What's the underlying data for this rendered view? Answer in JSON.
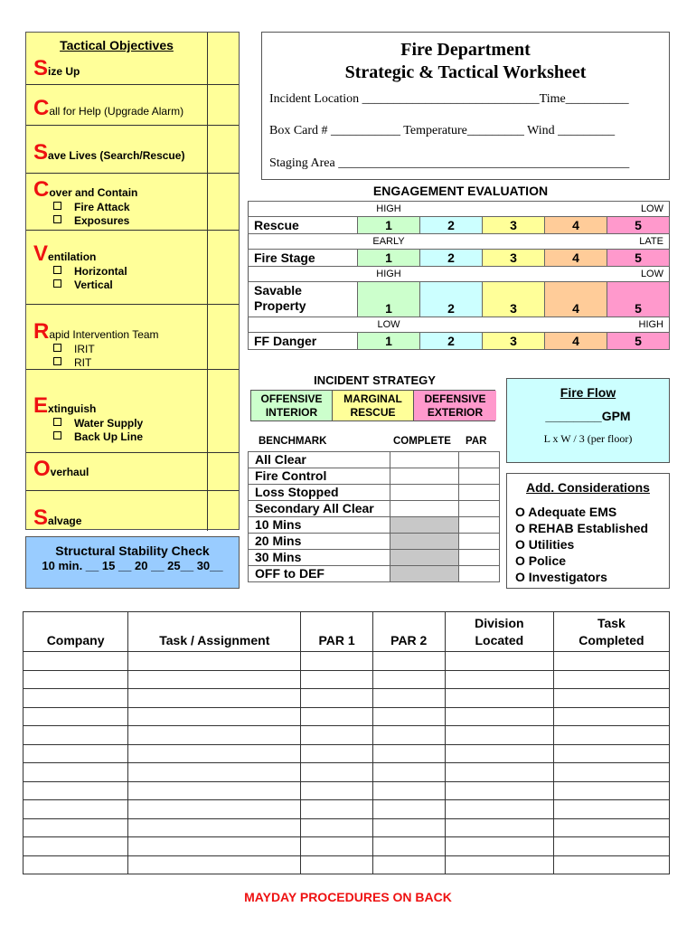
{
  "tactical_objectives": {
    "title": "Tactical Objectives",
    "items": [
      {
        "letter": "S",
        "rest": "ize Up",
        "subs": []
      },
      {
        "letter": "C",
        "rest": "all for Help (Upgrade Alarm)",
        "subs": []
      },
      {
        "letter": "S",
        "rest": "ave Lives  (Search/Rescue)",
        "subs": []
      },
      {
        "letter": "C",
        "rest": "over and Contain",
        "subs": [
          "Fire Attack",
          "Exposures"
        ]
      },
      {
        "letter": "V",
        "rest": "entilation",
        "subs": [
          "Horizontal",
          "Vertical"
        ]
      },
      {
        "letter": "R",
        "rest": "apid Intervention Team",
        "subs": [
          "IRIT",
          "RIT"
        ]
      },
      {
        "letter": "E",
        "rest": "xtinguish",
        "subs": [
          "Water Supply",
          "Back Up Line"
        ]
      },
      {
        "letter": "O",
        "rest": "verhaul",
        "subs": []
      },
      {
        "letter": "S",
        "rest": "alvage",
        "subs": []
      }
    ]
  },
  "structural_stability": {
    "title": "Structural Stability Check",
    "line": "10 min. __ 15 __ 20 __ 25__ 30__"
  },
  "header": {
    "title_line1": "Fire Department",
    "title_line2": "Strategic & Tactical Worksheet",
    "incident_location": "Incident Location ____________________________Time__________",
    "box_card": "Box Card #  ___________ Temperature_________ Wind _________",
    "staging_area": "Staging Area  ______________________________________________"
  },
  "engagement": {
    "title": "ENGAGEMENT EVALUATION",
    "colors": [
      "#ccffcc",
      "#ccffff",
      "#ffff99",
      "#ffcc99",
      "#ff99cc"
    ],
    "rows": [
      {
        "scale_left": "HIGH",
        "scale_right": "LOW",
        "label": "Rescue",
        "values": [
          "1",
          "2",
          "3",
          "4",
          "5"
        ]
      },
      {
        "scale_left": "EARLY",
        "scale_right": "LATE",
        "label": "Fire Stage",
        "values": [
          "1",
          "2",
          "3",
          "4",
          "5"
        ]
      },
      {
        "scale_left": "HIGH",
        "scale_right": "LOW",
        "label": "Savable Property",
        "values": [
          "1",
          "2",
          "3",
          "4",
          "5"
        ]
      },
      {
        "scale_left": "LOW",
        "scale_right": "HIGH",
        "label": "FF Danger",
        "values": [
          "1",
          "2",
          "3",
          "4",
          "5"
        ]
      }
    ]
  },
  "strategy": {
    "title": "INCIDENT STRATEGY",
    "options": [
      {
        "line1": "OFFENSIVE",
        "line2": "INTERIOR",
        "color": "#ccffcc"
      },
      {
        "line1": "MARGINAL",
        "line2": "RESCUE",
        "color": "#ffff99"
      },
      {
        "line1": "DEFENSIVE",
        "line2": "EXTERIOR",
        "color": "#ff99cc"
      }
    ]
  },
  "benchmarks": {
    "headers": {
      "benchmark": "BENCHMARK",
      "complete": "COMPLETE",
      "par": "PAR"
    },
    "rows": [
      {
        "label": "All Clear",
        "shaded": false
      },
      {
        "label": "Fire Control",
        "shaded": false
      },
      {
        "label": "Loss Stopped",
        "shaded": false
      },
      {
        "label": "Secondary All Clear",
        "shaded": false
      },
      {
        "label": "10 Mins",
        "shaded": true
      },
      {
        "label": "20 Mins",
        "shaded": true
      },
      {
        "label": "30 Mins",
        "shaded": true
      },
      {
        "label": "OFF to DEF",
        "shaded": true
      }
    ]
  },
  "fire_flow": {
    "title": "Fire Flow",
    "gpm": "________GPM",
    "formula": "L x W / 3 (per floor)"
  },
  "considerations": {
    "title": "Add. Considerations",
    "items": [
      "O Adequate EMS",
      "O REHAB Established",
      "O Utilities",
      "O Police",
      "O Investigators"
    ]
  },
  "crew_table": {
    "headers": [
      "Company",
      "Task / Assignment",
      "PAR 1",
      "PAR 2",
      "Division Located",
      "Task Completed"
    ],
    "row_count": 12
  },
  "footer": {
    "mayday": "MAYDAY PROCEDURES ON BACK"
  }
}
